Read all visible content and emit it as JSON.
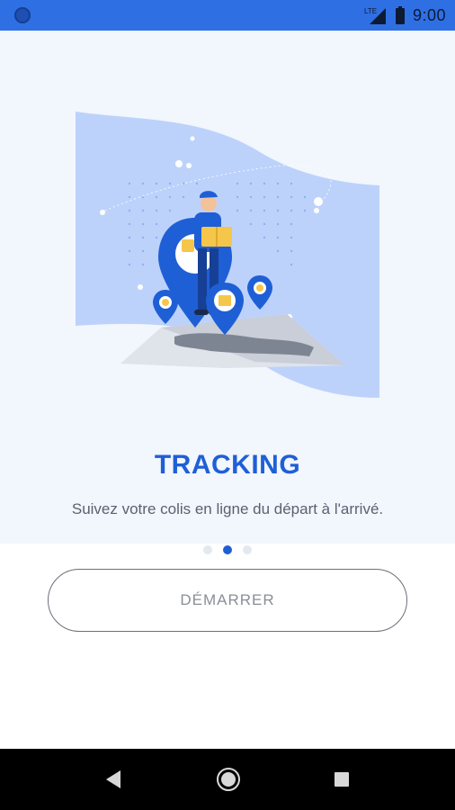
{
  "status_bar": {
    "network_label": "LTE",
    "time": "9:00",
    "icons": [
      "camera-dot-icon",
      "lte-signal-icon",
      "battery-icon"
    ]
  },
  "onboarding": {
    "title": "TRACKING",
    "subtitle": "Suivez votre colis en ligne du départ à l'arrivé.",
    "page_indicator": {
      "count": 3,
      "active_index": 1
    }
  },
  "actions": {
    "start_label": "DÉMARRER"
  },
  "navigation": {
    "icons": [
      "back-icon",
      "home-icon",
      "recents-icon"
    ]
  },
  "colors": {
    "status_bar": "#2f6fe4",
    "accent": "#1f5fd6",
    "hero_background": "#f2f6fd",
    "nav_bar": "#000000"
  }
}
